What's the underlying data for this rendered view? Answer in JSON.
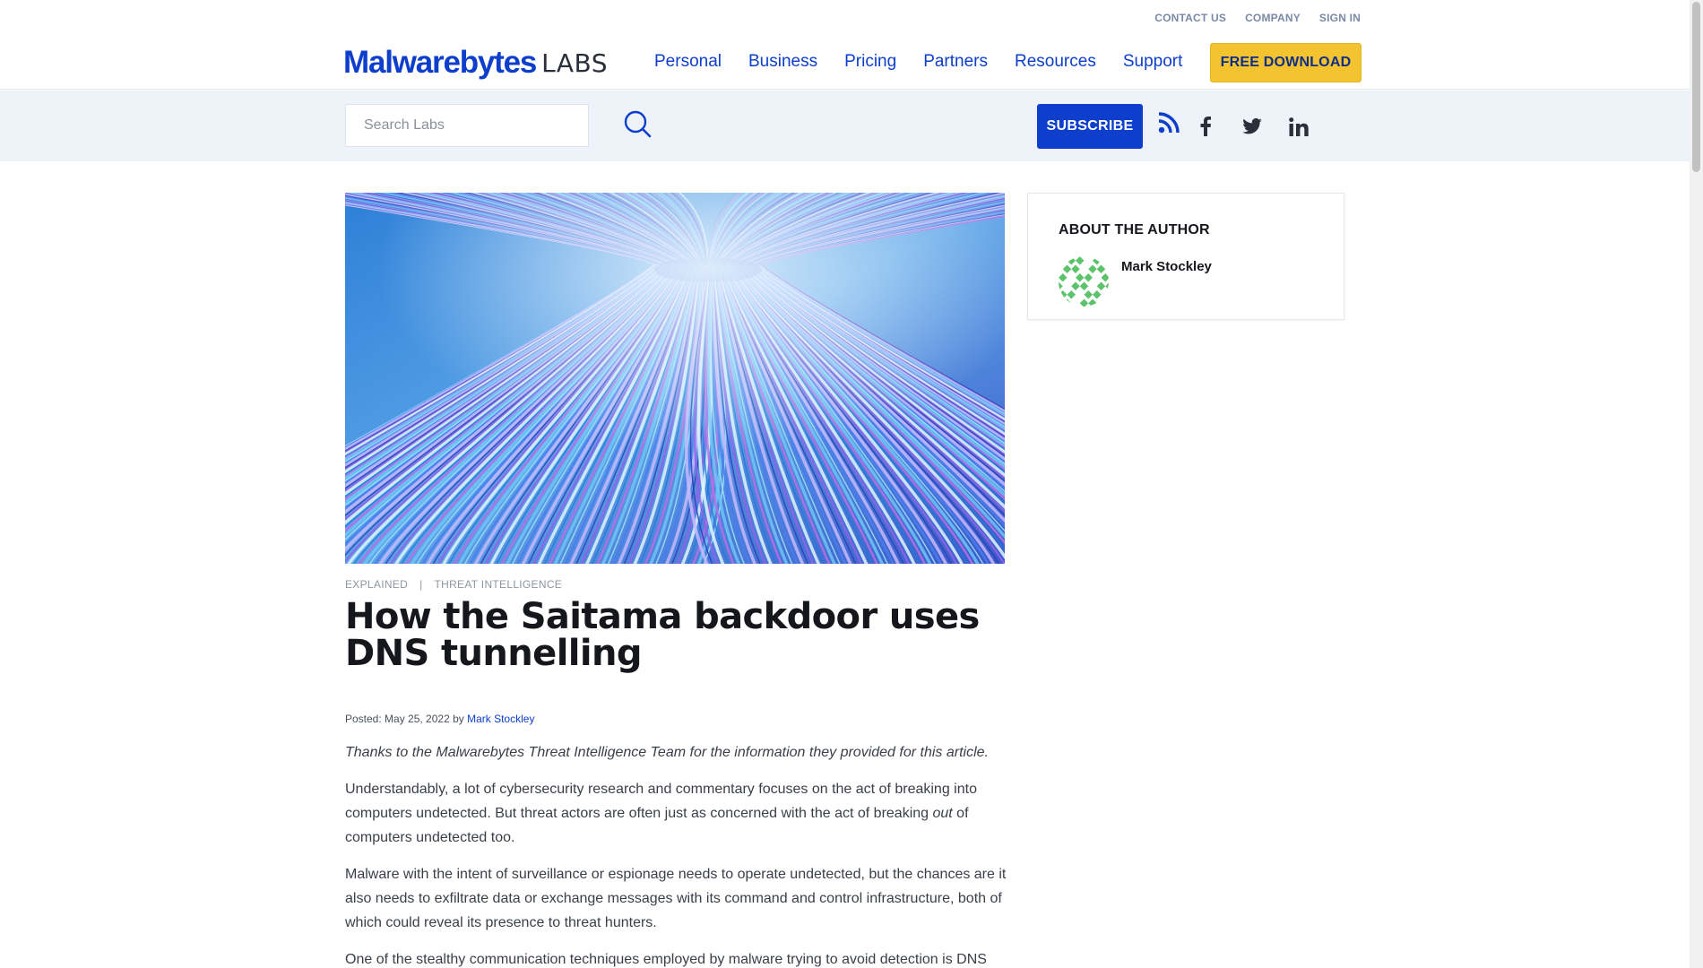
{
  "utility_nav": [
    "CONTACT US",
    "COMPANY",
    "SIGN IN"
  ],
  "logo": {
    "brand": "Malwarebytes",
    "suffix": "LABS"
  },
  "nav": [
    "Personal",
    "Business",
    "Pricing",
    "Partners",
    "Resources",
    "Support"
  ],
  "cta": {
    "free_download": "FREE DOWNLOAD",
    "subscribe": "SUBSCRIBE"
  },
  "search": {
    "placeholder": "Search Labs"
  },
  "social_icons": [
    "rss-icon",
    "facebook-icon",
    "twitter-icon",
    "linkedin-icon"
  ],
  "article": {
    "categories": [
      "EXPLAINED",
      "THREAT INTELLIGENCE"
    ],
    "separator": "|",
    "title": "How the Saitama backdoor uses DNS tunnelling",
    "posted_label": "Posted: May 25, 2022 by",
    "author": "Mark Stockley",
    "lead": "Thanks to the Malwarebytes Threat Intelligence Team for the information they provided for this article.",
    "paragraph_1_a": "Understandably, a lot of cybersecurity research and commentary focuses on the act of breaking into computers undetected. But threat actors are often just as concerned with the act of breaking ",
    "paragraph_1_em": "out",
    "paragraph_1_b": " of computers undetected too.",
    "paragraph_2": "Malware with the intent of surveillance or espionage needs to operate undetected, but the chances are it also needs to exfiltrate data or exchange messages with its command and control infrastructure, both of which could reveal its presence to threat hunters.",
    "paragraph_3": "One of the stealthy communication techniques employed by malware trying to avoid detection is DNS"
  },
  "sidebar": {
    "heading": "ABOUT THE AUTHOR",
    "author_name": "Mark Stockley"
  },
  "colors": {
    "brand_blue": "#0d3ecc",
    "cta_yellow": "#f4c430",
    "band_bg": "#eef3fa"
  }
}
